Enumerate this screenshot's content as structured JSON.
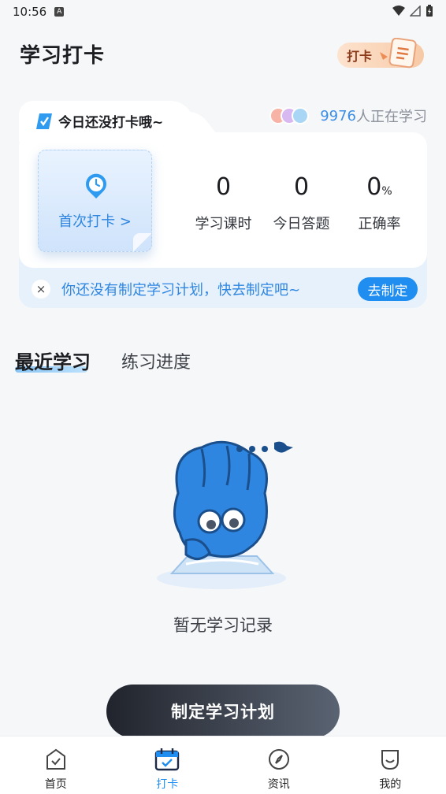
{
  "status_bar": {
    "time": "10:56",
    "notif_letter": "A"
  },
  "header": {
    "title": "学习打卡",
    "badge_text": "打卡"
  },
  "checkin_card": {
    "status": "今日还没打卡哦~",
    "learner_count": "9976",
    "learner_suffix": "人正在学习",
    "first_checkin_label": "首次打卡 >",
    "stats": [
      {
        "value": "0",
        "unit": "",
        "label": "学习课时"
      },
      {
        "value": "0",
        "unit": "",
        "label": "今日答题"
      },
      {
        "value": "0",
        "unit": "%",
        "label": "正确率"
      }
    ],
    "plan_hint": "你还没有制定学习计划，快去制定吧~",
    "plan_button": "去制定",
    "close_symbol": "×"
  },
  "tabs": {
    "recent": "最近学习",
    "progress": "练习进度"
  },
  "empty_state": {
    "text": "暂无学习记录"
  },
  "cta": {
    "label": "制定学习计划"
  },
  "bottom_nav": [
    {
      "label": "首页",
      "icon": "home-icon",
      "active": false
    },
    {
      "label": "打卡",
      "icon": "calendar-check-icon",
      "active": true
    },
    {
      "label": "资讯",
      "icon": "compass-icon",
      "active": false
    },
    {
      "label": "我的",
      "icon": "profile-icon",
      "active": false
    }
  ],
  "colors": {
    "accent": "#1f8ef0",
    "cta_dark": "#21242c",
    "card_bottom": "#e6f1fc"
  }
}
